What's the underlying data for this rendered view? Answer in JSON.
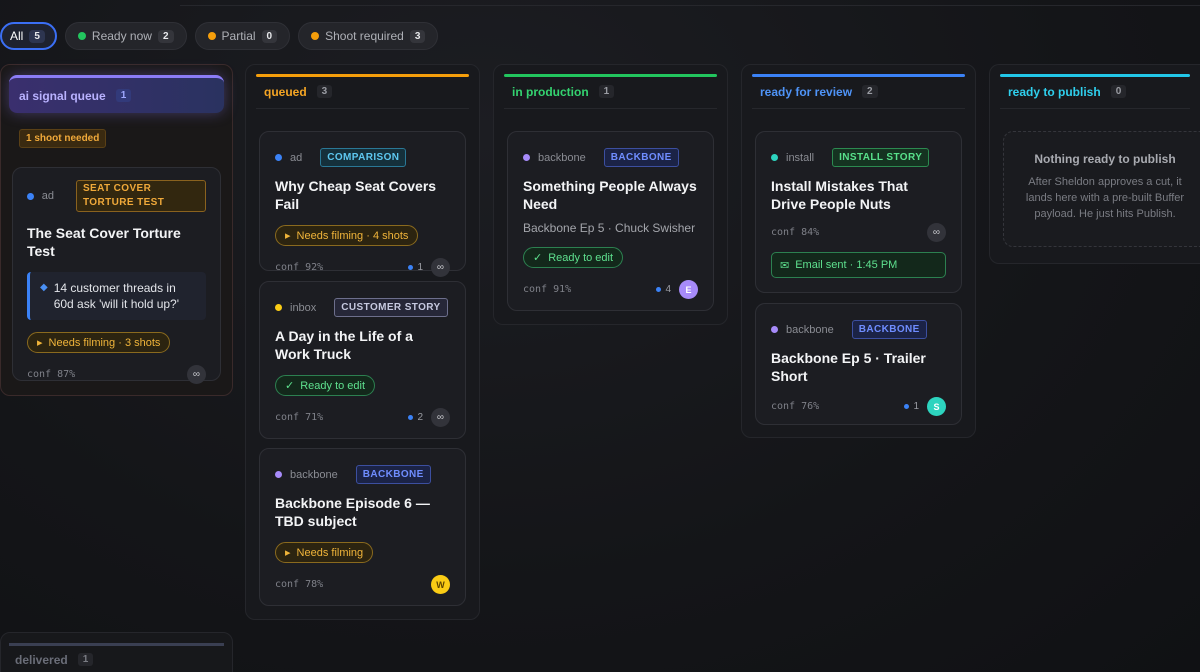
{
  "filters": [
    {
      "label": "All",
      "count": "5",
      "color": ""
    },
    {
      "label": "Ready now",
      "count": "2",
      "color": "#22c55e"
    },
    {
      "label": "Partial",
      "count": "0",
      "color": "#f59e0b"
    },
    {
      "label": "Shoot required",
      "count": "3",
      "color": "#f59e0b"
    }
  ],
  "columns": {
    "signal": {
      "title": "ai signal queue",
      "count": "1",
      "color": "#8b7cf6"
    },
    "queued": {
      "title": "queued",
      "count": "3",
      "color": "#f59e0b"
    },
    "production": {
      "title": "in production",
      "count": "1",
      "color": "#22c55e"
    },
    "review": {
      "title": "ready for review",
      "count": "2",
      "color": "#3b82f6"
    },
    "publish": {
      "title": "ready to publish",
      "count": "0",
      "color": "#22c7e8"
    },
    "delivered": {
      "title": "delivered",
      "count": "1"
    }
  },
  "signal": {
    "shoot_needed": "1 shoot needed",
    "card": {
      "type": "ad",
      "tag": "SEAT COVER TORTURE TEST",
      "title": "The Seat Cover Torture Test",
      "insight": "14 customer threads in 60d ask 'will it hold up?'",
      "status": "Needs filming · 3 shots",
      "conf": "conf 87%",
      "loop": "∞"
    }
  },
  "queued_cards": [
    {
      "type": "ad",
      "tag": "COMPARISON",
      "title": "Why Cheap Seat Covers Fail",
      "status": "Needs filming · 4 shots",
      "conf": "conf 92%",
      "comments": "1",
      "loop": "∞"
    },
    {
      "type": "inbox",
      "tag": "CUSTOMER STORY",
      "title": "A Day in the Life of a Work Truck",
      "status": "Ready to edit",
      "conf": "conf 71%",
      "comments": "2",
      "loop": "∞"
    },
    {
      "type": "backbone",
      "tag": "BACKBONE",
      "title": "Backbone Episode 6 — TBD subject",
      "status": "Needs filming",
      "conf": "conf 78%",
      "avatar": "W"
    }
  ],
  "production_card": {
    "type": "backbone",
    "tag": "BACKBONE",
    "title": "Something People Always Need",
    "subtitle": "Backbone Ep 5 · Chuck Swisher",
    "status": "Ready to edit",
    "conf": "conf 91%",
    "comments": "4",
    "avatar": "E"
  },
  "review_cards": [
    {
      "type": "install",
      "tag": "INSTALL STORY",
      "title": "Install Mistakes That Drive People Nuts",
      "conf": "conf 84%",
      "loop": "∞",
      "email": "Email sent · 1:45 PM"
    },
    {
      "type": "backbone",
      "tag": "BACKBONE",
      "title": "Backbone Ep 5 · Trailer Short",
      "conf": "conf 76%",
      "comments": "1",
      "avatar": "S"
    }
  ],
  "publish_empty": {
    "title": "Nothing ready to publish",
    "body": "After Sheldon approves a cut, it lands here with a pre-built Buffer payload. He just hits Publish."
  }
}
